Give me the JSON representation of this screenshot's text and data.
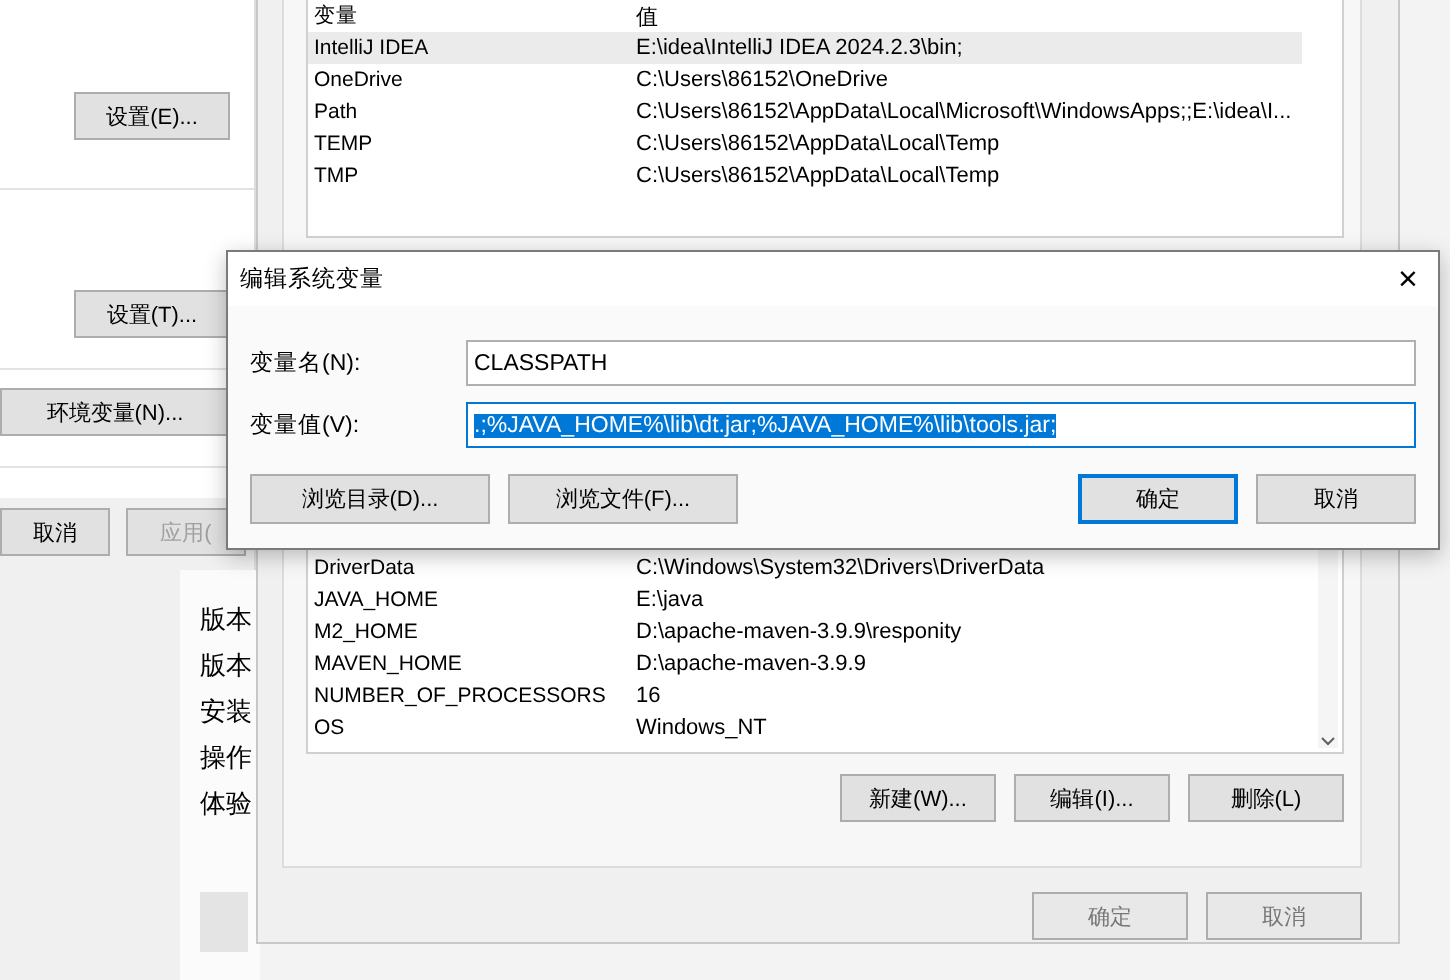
{
  "system_properties": {
    "buttons": [
      {
        "label": "设置(E)..."
      },
      {
        "label": "设置(T)..."
      },
      {
        "label": "环境变量(N)..."
      }
    ],
    "footer_buttons": [
      {
        "label": "取消",
        "disabled": false
      },
      {
        "label": "应用(",
        "disabled": true
      }
    ]
  },
  "about_page": {
    "labels": [
      "版本",
      "版本",
      "安装",
      "操作",
      "体验"
    ]
  },
  "environment_variables": {
    "user_table": {
      "columns": [
        "变量",
        "值"
      ],
      "rows": [
        {
          "name": "IntelliJ IDEA",
          "value": "E:\\idea\\IntelliJ IDEA 2024.2.3\\bin;",
          "selected": true
        },
        {
          "name": "OneDrive",
          "value": "C:\\Users\\86152\\OneDrive",
          "selected": false
        },
        {
          "name": "Path",
          "value": "C:\\Users\\86152\\AppData\\Local\\Microsoft\\WindowsApps;;E:\\idea\\I...",
          "selected": false
        },
        {
          "name": "TEMP",
          "value": "C:\\Users\\86152\\AppData\\Local\\Temp",
          "selected": false
        },
        {
          "name": "TMP",
          "value": "C:\\Users\\86152\\AppData\\Local\\Temp",
          "selected": false
        }
      ]
    },
    "system_table": {
      "rows": [
        {
          "name": "DriverData",
          "value": "C:\\Windows\\System32\\Drivers\\DriverData",
          "selected": false
        },
        {
          "name": "JAVA_HOME",
          "value": "E:\\java",
          "selected": false
        },
        {
          "name": "M2_HOME",
          "value": "D:\\apache-maven-3.9.9\\responity",
          "selected": false
        },
        {
          "name": "MAVEN_HOME",
          "value": "D:\\apache-maven-3.9.9",
          "selected": false
        },
        {
          "name": "NUMBER_OF_PROCESSORS",
          "value": "16",
          "selected": false
        },
        {
          "name": "OS",
          "value": "Windows_NT",
          "selected": false
        }
      ]
    },
    "table_buttons": [
      "新建(W)...",
      "编辑(I)...",
      "删除(L)"
    ],
    "footer_buttons": [
      "确定",
      "取消"
    ]
  },
  "edit_dialog": {
    "title": "编辑系统变量",
    "close": "×",
    "fields": [
      {
        "label": "变量名(N):",
        "value": "CLASSPATH",
        "selected": false
      },
      {
        "label": "变量值(V):",
        "value": ".;%JAVA_HOME%\\lib\\dt.jar;%JAVA_HOME%\\lib\\tools.jar;",
        "selected": true
      }
    ],
    "buttons": [
      {
        "label": "浏览目录(D)...",
        "default": false
      },
      {
        "label": "浏览文件(F)...",
        "default": false
      },
      {
        "label": "确定",
        "default": true
      },
      {
        "label": "取消",
        "default": false
      }
    ]
  }
}
